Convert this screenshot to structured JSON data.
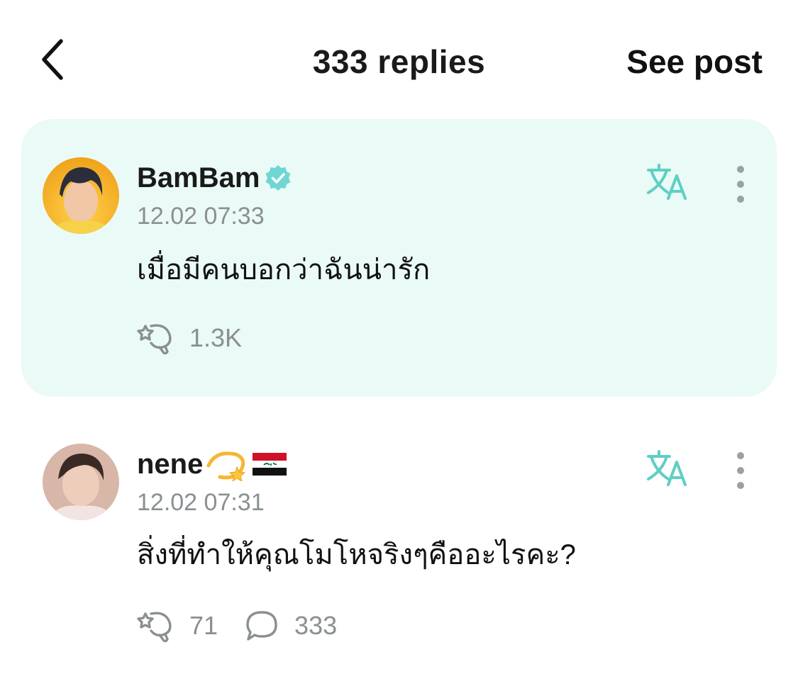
{
  "header": {
    "title": "333 replies",
    "see_post_label": "See post"
  },
  "post": {
    "author": "BamBam",
    "time": "12.02 07:33",
    "text": "เมื่อมีคนบอกว่าฉันน่ารัก",
    "likes": "1.3K"
  },
  "reply": {
    "author": "nene",
    "emoji": "💫",
    "flag": "iraq-flag",
    "time": "12.02 07:31",
    "text": "สิ่งที่ทำให้คุณโมโหจริงๆคืออะไรคะ?",
    "likes": "71",
    "comments": "333"
  },
  "colors": {
    "accent": "#5fcfc4",
    "card_bg": "#eafaf6",
    "muted": "#8a8f92",
    "verified": "#6fd6d3"
  },
  "icons": [
    "back-chevron-icon",
    "verified-badge-icon",
    "translate-icon",
    "more-vertical-icon",
    "like-icon",
    "comment-icon"
  ]
}
